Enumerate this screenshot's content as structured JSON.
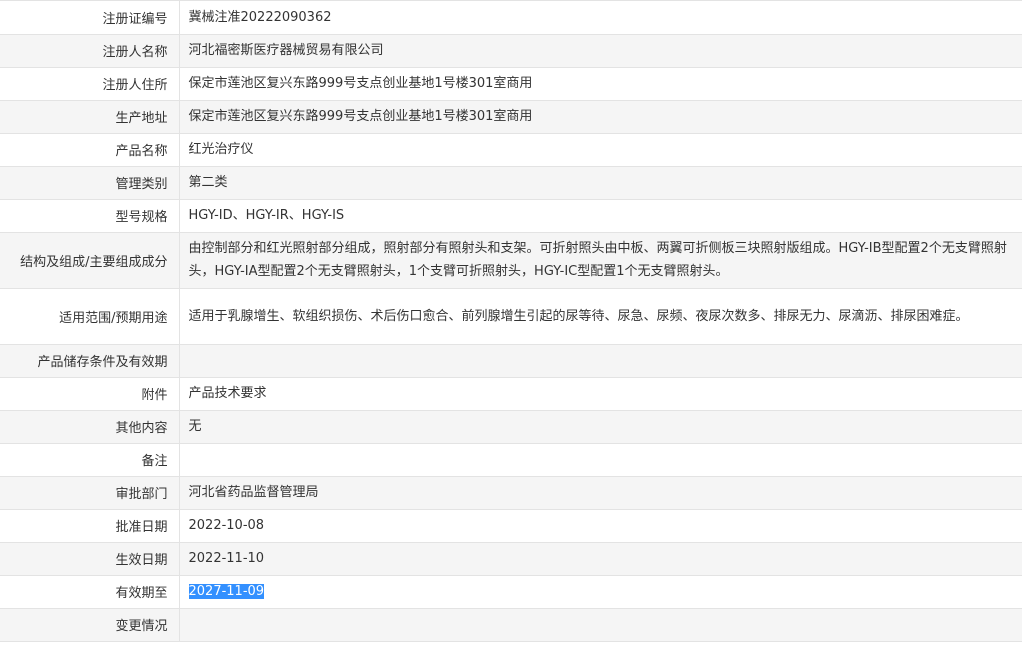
{
  "rows": [
    {
      "label": "注册证编号",
      "value": "冀械注准20222090362"
    },
    {
      "label": "注册人名称",
      "value": "河北福密斯医疗器械贸易有限公司"
    },
    {
      "label": "注册人住所",
      "value": "保定市莲池区复兴东路999号支点创业基地1号楼301室商用"
    },
    {
      "label": "生产地址",
      "value": "保定市莲池区复兴东路999号支点创业基地1号楼301室商用"
    },
    {
      "label": "产品名称",
      "value": "红光治疗仪"
    },
    {
      "label": "管理类别",
      "value": "第二类"
    },
    {
      "label": "型号规格",
      "value": "HGY-ID、HGY-IR、HGY-IS"
    },
    {
      "label": "结构及组成/主要组成成分",
      "value": "由控制部分和红光照射部分组成，照射部分有照射头和支架。可折射照头由中板、两翼可折侧板三块照射版组成。HGY-IB型配置2个无支臂照射头，HGY-IA型配置2个无支臂照射头，1个支臂可折照射头，HGY-IC型配置1个无支臂照射头。"
    },
    {
      "label": "适用范围/预期用途",
      "value": "适用于乳腺增生、软组织损伤、术后伤口愈合、前列腺增生引起的尿等待、尿急、尿频、夜尿次数多、排尿无力、尿滴沥、排尿困难症。"
    },
    {
      "label": "产品储存条件及有效期",
      "value": ""
    },
    {
      "label": "附件",
      "value": "产品技术要求"
    },
    {
      "label": "其他内容",
      "value": "无"
    },
    {
      "label": "备注",
      "value": ""
    },
    {
      "label": "审批部门",
      "value": "河北省药品监督管理局"
    },
    {
      "label": "批准日期",
      "value": "2022-10-08"
    },
    {
      "label": "生效日期",
      "value": "2022-11-10"
    },
    {
      "label": "有效期至",
      "value": "2027-11-09"
    },
    {
      "label": "变更情况",
      "value": ""
    }
  ]
}
